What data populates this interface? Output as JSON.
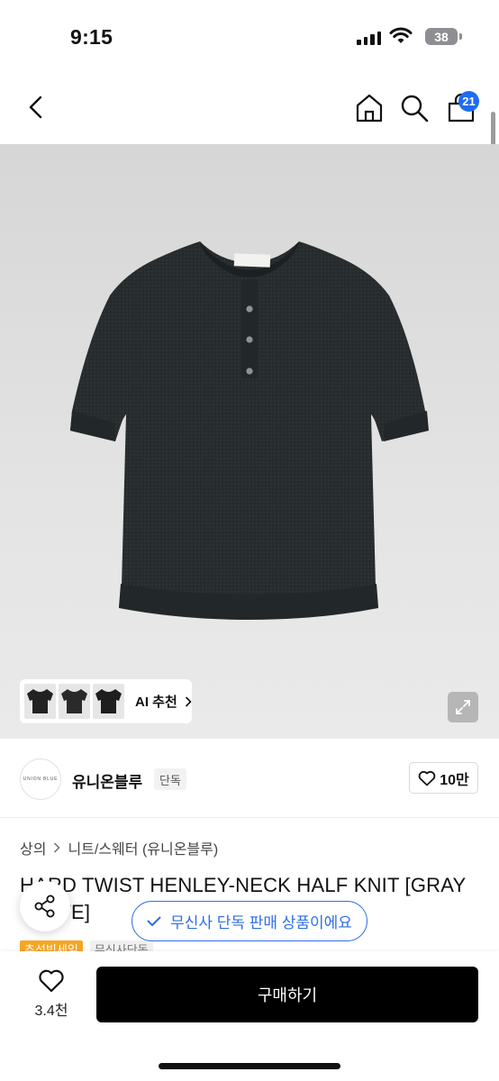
{
  "status_bar": {
    "time": "9:15",
    "battery": "38"
  },
  "nav": {
    "cart_count": "21"
  },
  "gallery": {
    "ai_recommend_label": "AI 추천"
  },
  "brand": {
    "logo_text": "UNION BLUE",
    "name": "유니온블루",
    "tag": "단독",
    "likes": "10만"
  },
  "breadcrumb": {
    "category": "상의",
    "subcategory": "니트/스웨터 (유니온블루)"
  },
  "product": {
    "title": "HARD TWIST HENLEY-NECK HALF KNIT [GRAY WHITE]",
    "badges": [
      "추석빅세일",
      "무신사단독"
    ]
  },
  "exclusive_notice": "무신사 단독 판매 상품이에요",
  "bottom_bar": {
    "wish_count": "3.4천",
    "buy_label": "구매하기"
  },
  "colors": {
    "accent_blue": "#2f6fe4",
    "badge_blue": "#1d6cf2",
    "promo_orange": "#f5a623",
    "knit": "#24292b"
  }
}
